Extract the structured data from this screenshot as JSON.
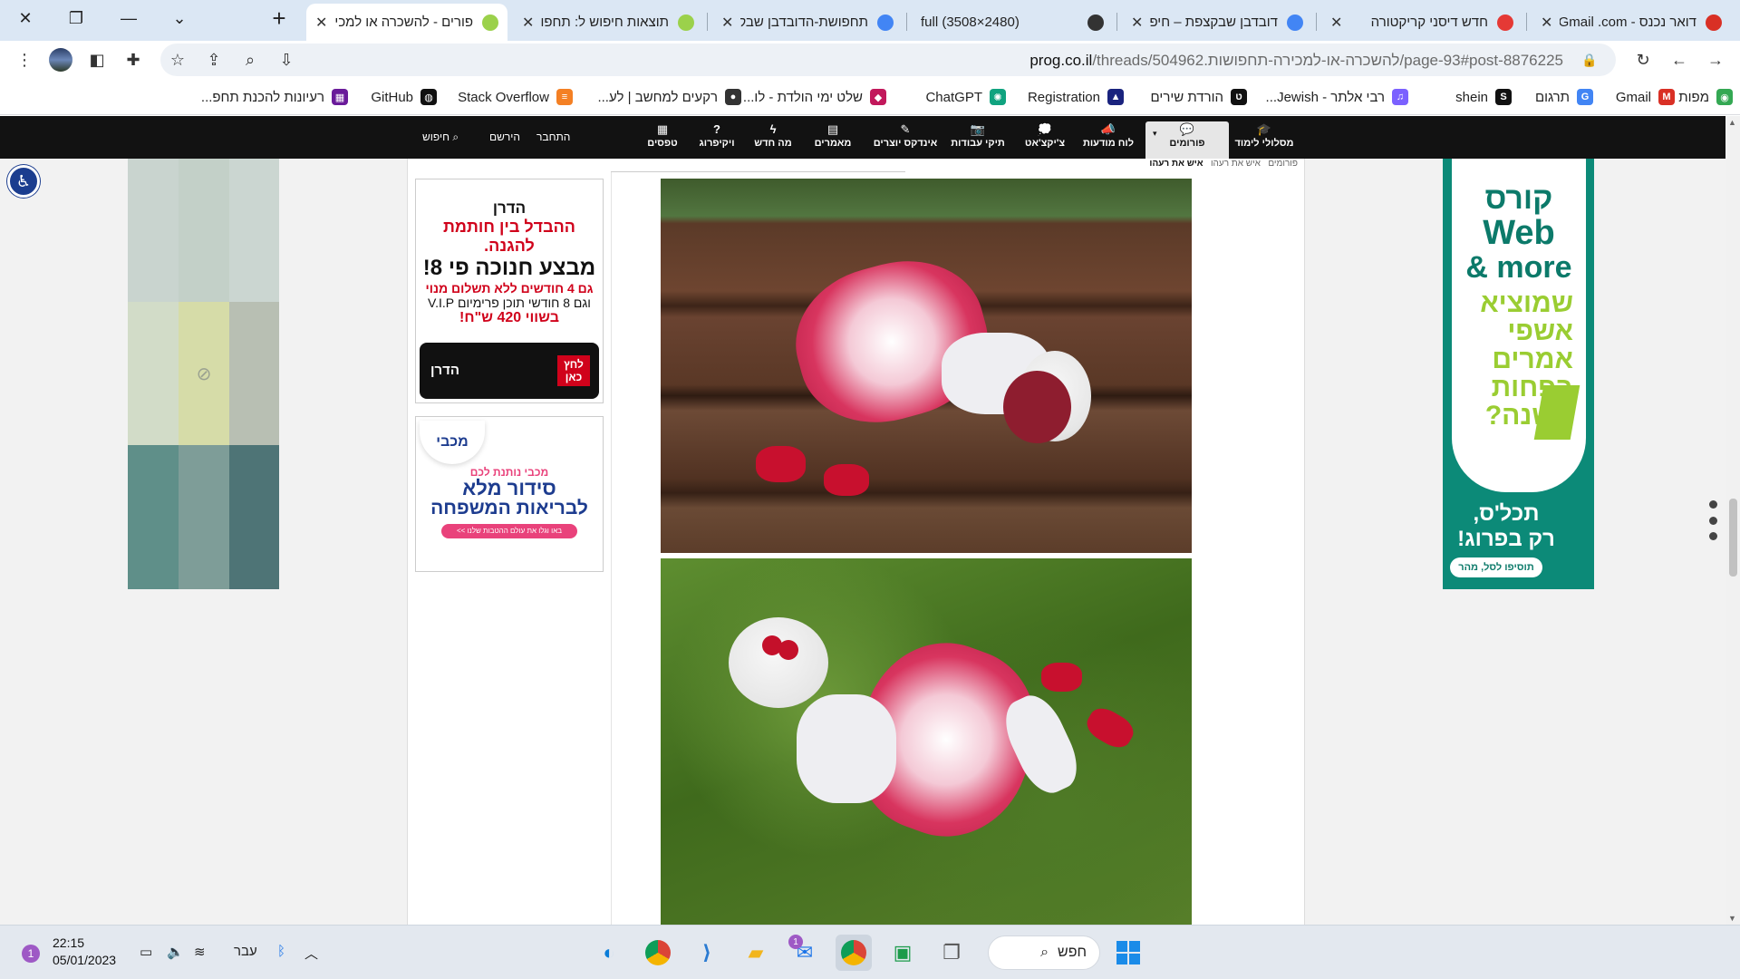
{
  "browser": {
    "tabs": [
      {
        "title": "פורים - להשכרה או למכירה",
        "favicon_color": "#9bd14b",
        "active": true
      },
      {
        "title": "תוצאות חיפוש ל: תחפושת",
        "favicon_color": "#9bd14b",
        "active": false
      },
      {
        "title": "תחפושת-הדובדבן שבקצפת",
        "favicon_color": "#4285f4",
        "active": false
      },
      {
        "title": "full (3508×2480)",
        "favicon_color": "#333333",
        "active": false
      },
      {
        "title": "דובדבן שבקצפת – חיפוש",
        "favicon_color": "#4285f4",
        "active": false
      },
      {
        "title": "חדש דיסני קריקטורה",
        "favicon_color": "#e53935",
        "active": false
      },
      {
        "title": "דואר נכנס - Gmail .com",
        "favicon_color": "#d93025",
        "active": false
      }
    ],
    "new_tab_label": "+",
    "url_domain": "prog.co.il",
    "url_path": "/threads/504962.להשכרה-או-למכירה-תחפושות/page-93#post-8876225",
    "bookmarks": [
      {
        "label": "מפות",
        "color": "#34a853",
        "glyph": "◉"
      },
      {
        "label": "Gmail",
        "color": "#d93025",
        "glyph": "M"
      },
      {
        "label": "תרגום",
        "color": "#4285f4",
        "glyph": "G"
      },
      {
        "label": "shein",
        "color": "#111111",
        "glyph": "S"
      },
      {
        "label": "רבי אלתר - Jewish...",
        "color": "#7b61ff",
        "glyph": "♫"
      },
      {
        "label": "הורדת שירים",
        "color": "#111111",
        "glyph": "ט"
      },
      {
        "label": "Registration",
        "color": "#1a237e",
        "glyph": "▲"
      },
      {
        "label": "ChatGPT",
        "color": "#10a37f",
        "glyph": "✺"
      },
      {
        "label": "שלט ימי הולדת - לו...",
        "color": "#c2185b",
        "glyph": "◆"
      },
      {
        "label": "רקעים למחשב | לע...",
        "color": "#333333",
        "glyph": "●"
      },
      {
        "label": "Stack Overflow",
        "color": "#f48024",
        "glyph": "≡"
      },
      {
        "label": "GitHub",
        "color": "#111111",
        "glyph": "◍"
      },
      {
        "label": "רעיונות להכנת תחפ...",
        "color": "#6a1b9a",
        "glyph": "▦"
      }
    ]
  },
  "site_nav": {
    "items": [
      {
        "label": "מסלולי לימוד",
        "icon": "graduation-cap-icon",
        "glyph": "🎓"
      },
      {
        "label": "פורומים",
        "icon": "forum-icon",
        "glyph": "💬",
        "selected": true
      },
      {
        "label": "לוח מודעות",
        "icon": "megaphone-icon",
        "glyph": "📣"
      },
      {
        "label": "צ'יקצ'אט",
        "icon": "chat-icon",
        "glyph": "💭"
      },
      {
        "label": "תיקי עבודות",
        "icon": "camera-icon",
        "glyph": "📷"
      },
      {
        "label": "אינדקס יוצרים",
        "icon": "pen-icon",
        "glyph": "✎"
      },
      {
        "label": "מאמרים",
        "icon": "article-icon",
        "glyph": "▤"
      },
      {
        "label": "מה חדש",
        "icon": "bolt-icon",
        "glyph": "ϟ"
      },
      {
        "label": "ויקיפרוג",
        "icon": "question-icon",
        "glyph": "?"
      },
      {
        "label": "טפסים",
        "icon": "form-icon",
        "glyph": "▦"
      }
    ],
    "login": "התחבר",
    "register": "הירשם",
    "search": "חיפוש"
  },
  "breadcrumbs": [
    "פורומים",
    "איש את רעהו",
    "איש את רעהו"
  ],
  "ads": {
    "left_top": {
      "brand_top": "הדרן",
      "line1": "ההבדל בין חותמת להגנה.",
      "line2": "מבצע חנוכה פי 8!",
      "line3": "גם 4 חודשים ללא תשלום מנוי",
      "line4": "וגם 8 חודשי תוכן פרימיום V.I.P",
      "line5": "בשווי 420 ש\"ח!",
      "cta": "לחץ כאן",
      "brand_bottom": "הדרן"
    },
    "left_bottom": {
      "brand": "מכבי",
      "line1": "מכבי נותנת לכם",
      "line2": "סידור מלא",
      "line3": "לבריאות המשפחה",
      "cta": "באו וגלו את עולם ההטבות שלנו >>"
    },
    "right": {
      "line1": "קורס",
      "line2": "Web",
      "line3": "& more",
      "line4": "שמוציא",
      "line5": "אשפי",
      "line6": "אמרים",
      "line7": "בפחות",
      "line8": "משנה?",
      "line9": "תכל'ס,",
      "line10": "רק בפרוג!",
      "cta": "תוסיפו לסל, מהר"
    }
  },
  "palette_colors": [
    "#c9d4cf",
    "#c3d0c8",
    "#cbd6d1",
    "#d2dcc8",
    "#d6dca8",
    "#b8bfb3",
    "#5f8f89",
    "#7e9d98",
    "#4e7476"
  ],
  "taskbar": {
    "search_label": "חפש",
    "time": "22:15",
    "date": "05/01/2023",
    "language": "עבר",
    "notifications": "1",
    "mail_badge": "1"
  }
}
